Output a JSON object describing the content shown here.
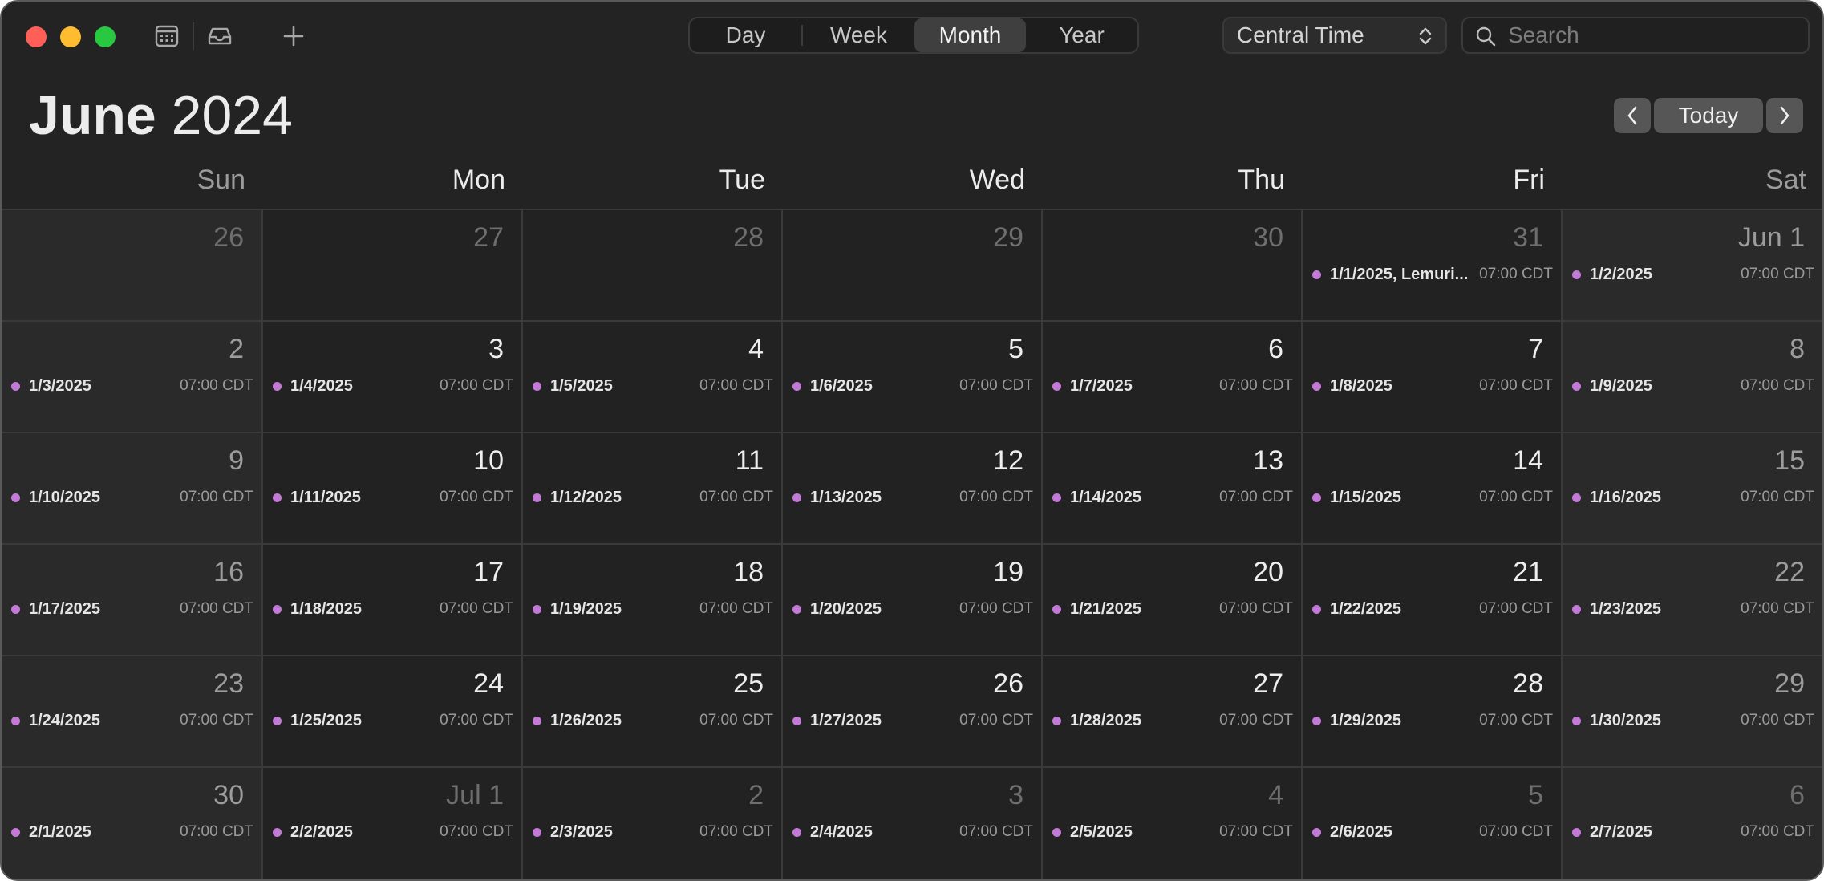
{
  "toolbar": {
    "views": [
      "Day",
      "Week",
      "Month",
      "Year"
    ],
    "active_view": "Month",
    "timezone": "Central Time",
    "search_placeholder": "Search",
    "icons": [
      "calendar-list-icon",
      "inbox-icon",
      "plus-icon"
    ]
  },
  "header": {
    "month": "June",
    "year": "2024",
    "today_label": "Today"
  },
  "weekdays": [
    "Sun",
    "Mon",
    "Tue",
    "Wed",
    "Thu",
    "Fri",
    "Sat"
  ],
  "colors": {
    "event_dot": "#c37ad6",
    "background": "#232323"
  },
  "weeks": [
    [
      {
        "day": "26",
        "dim": true,
        "event": null
      },
      {
        "day": "27",
        "dim": true,
        "event": null
      },
      {
        "day": "28",
        "dim": true,
        "event": null
      },
      {
        "day": "29",
        "dim": true,
        "event": null
      },
      {
        "day": "30",
        "dim": true,
        "event": null
      },
      {
        "day": "31",
        "dim": true,
        "event": {
          "title": "1/1/2025, Lemuri...",
          "time": "07:00 CDT"
        }
      },
      {
        "day": "Jun 1",
        "dim": false,
        "event": {
          "title": "1/2/2025",
          "time": "07:00 CDT"
        }
      }
    ],
    [
      {
        "day": "2",
        "dim": false,
        "event": {
          "title": "1/3/2025",
          "time": "07:00 CDT"
        }
      },
      {
        "day": "3",
        "dim": false,
        "event": {
          "title": "1/4/2025",
          "time": "07:00 CDT"
        }
      },
      {
        "day": "4",
        "dim": false,
        "event": {
          "title": "1/5/2025",
          "time": "07:00 CDT"
        }
      },
      {
        "day": "5",
        "dim": false,
        "event": {
          "title": "1/6/2025",
          "time": "07:00 CDT"
        }
      },
      {
        "day": "6",
        "dim": false,
        "event": {
          "title": "1/7/2025",
          "time": "07:00 CDT"
        }
      },
      {
        "day": "7",
        "dim": false,
        "event": {
          "title": "1/8/2025",
          "time": "07:00 CDT"
        }
      },
      {
        "day": "8",
        "dim": false,
        "event": {
          "title": "1/9/2025",
          "time": "07:00 CDT"
        }
      }
    ],
    [
      {
        "day": "9",
        "dim": false,
        "event": {
          "title": "1/10/2025",
          "time": "07:00 CDT"
        }
      },
      {
        "day": "10",
        "dim": false,
        "event": {
          "title": "1/11/2025",
          "time": "07:00 CDT"
        }
      },
      {
        "day": "11",
        "dim": false,
        "event": {
          "title": "1/12/2025",
          "time": "07:00 CDT"
        }
      },
      {
        "day": "12",
        "dim": false,
        "event": {
          "title": "1/13/2025",
          "time": "07:00 CDT"
        }
      },
      {
        "day": "13",
        "dim": false,
        "event": {
          "title": "1/14/2025",
          "time": "07:00 CDT"
        }
      },
      {
        "day": "14",
        "dim": false,
        "event": {
          "title": "1/15/2025",
          "time": "07:00 CDT"
        }
      },
      {
        "day": "15",
        "dim": false,
        "event": {
          "title": "1/16/2025",
          "time": "07:00 CDT"
        }
      }
    ],
    [
      {
        "day": "16",
        "dim": false,
        "event": {
          "title": "1/17/2025",
          "time": "07:00 CDT"
        }
      },
      {
        "day": "17",
        "dim": false,
        "event": {
          "title": "1/18/2025",
          "time": "07:00 CDT"
        }
      },
      {
        "day": "18",
        "dim": false,
        "event": {
          "title": "1/19/2025",
          "time": "07:00 CDT"
        }
      },
      {
        "day": "19",
        "dim": false,
        "event": {
          "title": "1/20/2025",
          "time": "07:00 CDT"
        }
      },
      {
        "day": "20",
        "dim": false,
        "event": {
          "title": "1/21/2025",
          "time": "07:00 CDT"
        }
      },
      {
        "day": "21",
        "dim": false,
        "event": {
          "title": "1/22/2025",
          "time": "07:00 CDT"
        }
      },
      {
        "day": "22",
        "dim": false,
        "event": {
          "title": "1/23/2025",
          "time": "07:00 CDT"
        }
      }
    ],
    [
      {
        "day": "23",
        "dim": false,
        "event": {
          "title": "1/24/2025",
          "time": "07:00 CDT"
        }
      },
      {
        "day": "24",
        "dim": false,
        "event": {
          "title": "1/25/2025",
          "time": "07:00 CDT"
        }
      },
      {
        "day": "25",
        "dim": false,
        "event": {
          "title": "1/26/2025",
          "time": "07:00 CDT"
        }
      },
      {
        "day": "26",
        "dim": false,
        "event": {
          "title": "1/27/2025",
          "time": "07:00 CDT"
        }
      },
      {
        "day": "27",
        "dim": false,
        "event": {
          "title": "1/28/2025",
          "time": "07:00 CDT"
        }
      },
      {
        "day": "28",
        "dim": false,
        "event": {
          "title": "1/29/2025",
          "time": "07:00 CDT"
        }
      },
      {
        "day": "29",
        "dim": false,
        "event": {
          "title": "1/30/2025",
          "time": "07:00 CDT"
        }
      }
    ],
    [
      {
        "day": "30",
        "dim": false,
        "event": {
          "title": "2/1/2025",
          "time": "07:00 CDT"
        }
      },
      {
        "day": "Jul 1",
        "dim": true,
        "event": {
          "title": "2/2/2025",
          "time": "07:00 CDT"
        }
      },
      {
        "day": "2",
        "dim": true,
        "event": {
          "title": "2/3/2025",
          "time": "07:00 CDT"
        }
      },
      {
        "day": "3",
        "dim": true,
        "event": {
          "title": "2/4/2025",
          "time": "07:00 CDT"
        }
      },
      {
        "day": "4",
        "dim": true,
        "event": {
          "title": "2/5/2025",
          "time": "07:00 CDT"
        }
      },
      {
        "day": "5",
        "dim": true,
        "event": {
          "title": "2/6/2025",
          "time": "07:00 CDT"
        }
      },
      {
        "day": "6",
        "dim": true,
        "event": {
          "title": "2/7/2025",
          "time": "07:00 CDT"
        }
      }
    ]
  ]
}
